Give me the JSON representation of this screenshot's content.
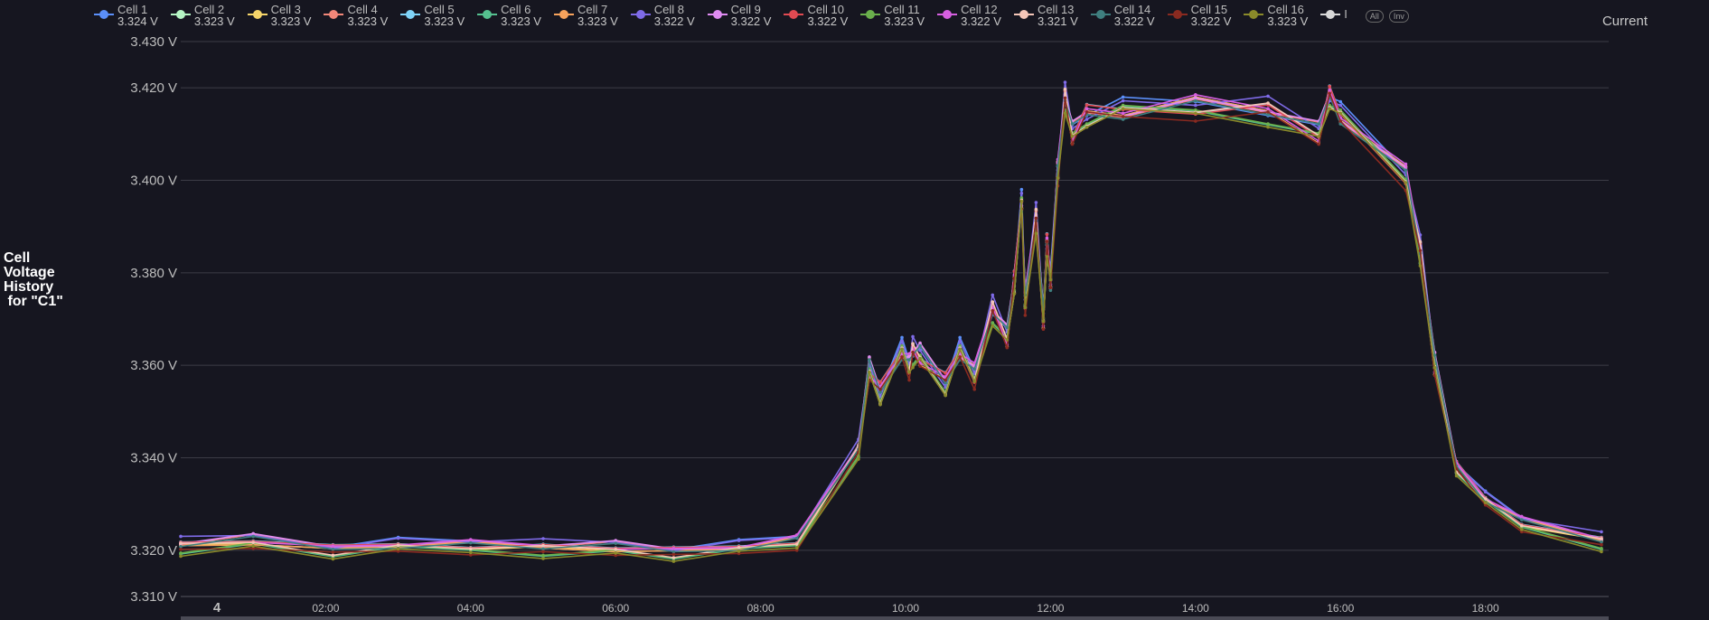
{
  "chart_data": {
    "type": "line",
    "title": "Cell\nVoltage\nHistory\n for \"C1\"",
    "right_label": "Current",
    "legend_extra": "I",
    "buttons": {
      "all": "All",
      "inv": "Inv"
    },
    "y_tick_labels": [
      "3.310 V",
      "3.320 V",
      "3.340 V",
      "3.360 V",
      "3.380 V",
      "3.400 V",
      "3.420 V",
      "3.430 V"
    ],
    "y_ticks": [
      3.31,
      3.32,
      3.34,
      3.36,
      3.38,
      3.4,
      3.42,
      3.43
    ],
    "ylim": [
      3.31,
      3.43
    ],
    "x_tick_labels": [
      "4",
      "02:00",
      "04:00",
      "06:00",
      "08:00",
      "10:00",
      "12:00",
      "14:00",
      "16:00",
      "18:00"
    ],
    "x_ticks": [
      0.5,
      2,
      4,
      6,
      8,
      10,
      12,
      14,
      16,
      18
    ],
    "xlim": [
      0,
      19.7
    ],
    "grid": true,
    "legend_position": "top",
    "base": {
      "x": [
        0,
        1,
        2.1,
        3,
        4,
        5,
        6,
        6.8,
        7.7,
        8.5,
        9.35,
        9.5,
        9.65,
        9.95,
        10.05,
        10.1,
        10.2,
        10.55,
        10.75,
        10.95,
        11.2,
        11.4,
        11.5,
        11.6,
        11.65,
        11.8,
        11.9,
        11.95,
        12.0,
        12.1,
        12.2,
        12.3,
        12.5,
        13,
        14,
        15,
        15.7,
        15.85,
        16,
        16.9,
        17.1,
        17.3,
        17.6,
        18,
        18.5,
        19.6
      ],
      "y": [
        3.321,
        3.322,
        3.32,
        3.321,
        3.321,
        3.3205,
        3.3205,
        3.3195,
        3.3205,
        3.322,
        3.342,
        3.359,
        3.354,
        3.363,
        3.36,
        3.363,
        3.362,
        3.356,
        3.363,
        3.358,
        3.372,
        3.366,
        3.378,
        3.395,
        3.374,
        3.392,
        3.37,
        3.386,
        3.378,
        3.402,
        3.418,
        3.41,
        3.414,
        3.415,
        3.416,
        3.415,
        3.41,
        3.418,
        3.414,
        3.401,
        3.385,
        3.36,
        3.338,
        3.331,
        3.326,
        3.322
      ]
    },
    "series": [
      {
        "name": "Cell 1",
        "latest": "3.324 V",
        "color": "#5b8ff9",
        "offset": 0.001
      },
      {
        "name": "Cell 2",
        "latest": "3.323 V",
        "color": "#b5f5c4",
        "offset": 0.0
      },
      {
        "name": "Cell 3",
        "latest": "3.323 V",
        "color": "#f6d56a",
        "offset": -0.0005
      },
      {
        "name": "Cell 4",
        "latest": "3.323 V",
        "color": "#f28779",
        "offset": 0.0006
      },
      {
        "name": "Cell 5",
        "latest": "3.323 V",
        "color": "#7fd3f7",
        "offset": 0.0004
      },
      {
        "name": "Cell 6",
        "latest": "3.323 V",
        "color": "#55c08f",
        "offset": -0.001
      },
      {
        "name": "Cell 7",
        "latest": "3.323 V",
        "color": "#f7a35c",
        "offset": 0.0
      },
      {
        "name": "Cell 8",
        "latest": "3.322 V",
        "color": "#7f6be8",
        "offset": 0.0012
      },
      {
        "name": "Cell 9",
        "latest": "3.322 V",
        "color": "#e08cf2",
        "offset": 0.0008
      },
      {
        "name": "Cell 10",
        "latest": "3.322 V",
        "color": "#e04a52",
        "offset": 0.0003
      },
      {
        "name": "Cell 11",
        "latest": "3.323 V",
        "color": "#6ab04c",
        "offset": -0.0008
      },
      {
        "name": "Cell 12",
        "latest": "3.322 V",
        "color": "#d65fe0",
        "offset": 0.0005
      },
      {
        "name": "Cell 13",
        "latest": "3.321 V",
        "color": "#f4c6b8",
        "offset": -0.0003
      },
      {
        "name": "Cell 14",
        "latest": "3.322 V",
        "color": "#3f7f7f",
        "offset": 0.0002
      },
      {
        "name": "Cell 15",
        "latest": "3.322 V",
        "color": "#8a2a20",
        "offset": -0.0012
      },
      {
        "name": "Cell 16",
        "latest": "3.323 V",
        "color": "#8a8a2a",
        "offset": -0.0015
      }
    ],
    "extra_color": "#d8d8d8"
  }
}
